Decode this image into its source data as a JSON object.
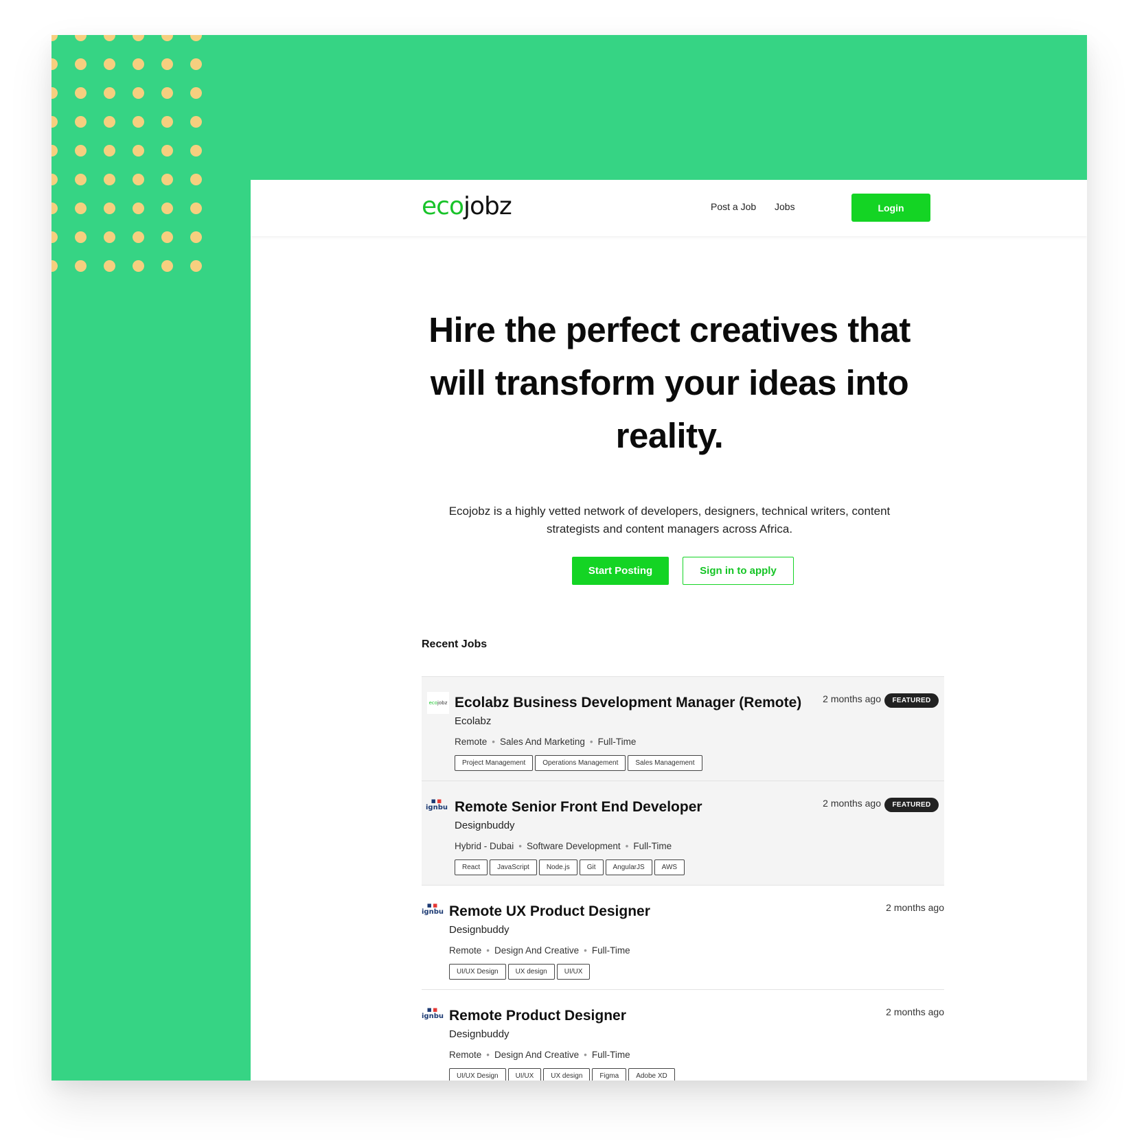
{
  "nav": {
    "logo_eco": "eco",
    "logo_jobz": "jobz",
    "post_job": "Post a Job",
    "jobs": "Jobs",
    "login": "Login"
  },
  "hero": {
    "title": "Hire the perfect creatives that will transform your ideas into reality.",
    "subtitle": "Ecojobz is a highly vetted network of developers, designers, technical writers, content strategists and content managers across Africa.",
    "start_posting": "Start Posting",
    "sign_in": "Sign in to apply"
  },
  "recent": {
    "heading": "Recent Jobs",
    "jobs": [
      {
        "title": "Ecolabz Business Development Manager (Remote)",
        "company": "Ecolabz",
        "location": "Remote",
        "category": "Sales And Marketing",
        "type": "Full-Time",
        "time": "2 months ago",
        "badge": "FEATURED",
        "logo": "ecojobz",
        "tags": [
          "Project Management",
          "Operations Management",
          "Sales Management"
        ]
      },
      {
        "title": "Remote Senior Front End Developer",
        "company": "Designbuddy",
        "location": "Hybrid - Dubai",
        "category": "Software Development",
        "type": "Full-Time",
        "time": "2 months ago",
        "badge": "FEATURED",
        "logo": "ignbu",
        "tags": [
          "React",
          "JavaScript",
          "Node.js",
          "Git",
          "AngularJS",
          "AWS"
        ]
      },
      {
        "title": "Remote UX Product Designer",
        "company": "Designbuddy",
        "location": "Remote",
        "category": "Design And Creative",
        "type": "Full-Time",
        "time": "2 months ago",
        "badge": "",
        "logo": "ignbu",
        "tags": [
          "UI/UX Design",
          "UX design",
          "UI/UX"
        ]
      },
      {
        "title": "Remote Product Designer",
        "company": "Designbuddy",
        "location": "Remote",
        "category": "Design And Creative",
        "type": "Full-Time",
        "time": "2 months ago",
        "badge": "",
        "logo": "ignbu",
        "tags": [
          "UI/UX Design",
          "UI/UX",
          "UX design",
          "Figma",
          "Adobe XD"
        ]
      }
    ]
  },
  "colors": {
    "frame_green": "#36d484",
    "accent_green": "#14d424",
    "dot_yellow": "#f6cf7f",
    "badge_dark": "#222222"
  }
}
